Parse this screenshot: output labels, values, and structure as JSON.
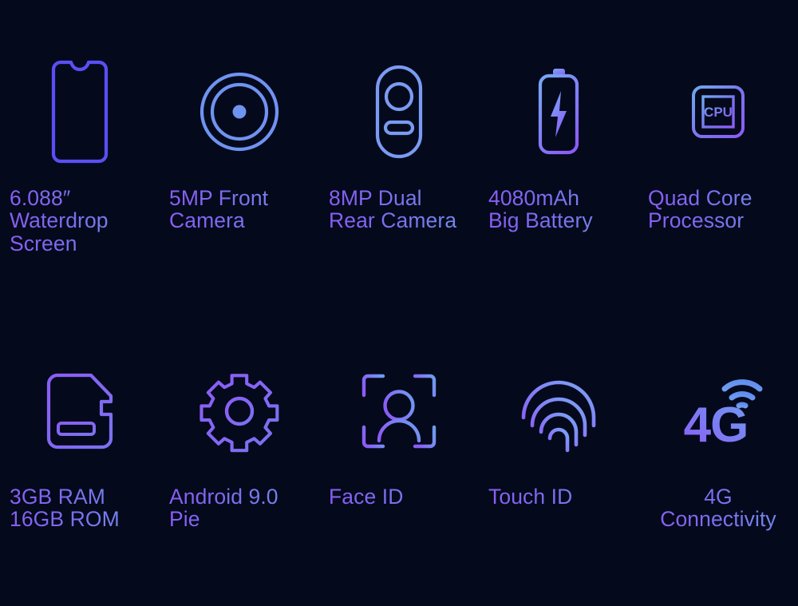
{
  "page": {
    "background_color": "#05091c",
    "layout": "2 rows x 5 columns feature grid",
    "text_gradient_from": "#8b5cf6",
    "text_gradient_to": "#6f8fe8"
  },
  "features": [
    {
      "id": "waterdrop-screen",
      "icon": "phone-waterdrop-notch-icon",
      "icon_color_from": "#5a4ef5",
      "icon_color_to": "#5a4ef5",
      "label": "6.088″\nWaterdrop\nScreen",
      "align": "left"
    },
    {
      "id": "front-camera",
      "icon": "front-camera-lens-icon",
      "icon_color_from": "#6f93f0",
      "icon_color_to": "#6f93f0",
      "label": "5MP Front\nCamera",
      "align": "left"
    },
    {
      "id": "rear-camera",
      "icon": "dual-rear-camera-module-icon",
      "icon_color_from": "#7a9bf2",
      "icon_color_to": "#7a9bf2",
      "label": "8MP Dual\nRear Camera",
      "align": "left"
    },
    {
      "id": "battery",
      "icon": "battery-bolt-icon",
      "icon_color_from": "#77a4f5",
      "icon_color_to": "#8b5cf6",
      "label": "4080mAh\nBig Battery",
      "align": "left"
    },
    {
      "id": "processor",
      "icon": "cpu-chip-icon",
      "icon_color_from": "#6fa8f0",
      "icon_color_to": "#8b5cf6",
      "icon_text": "CPU",
      "label": "Quad Core\nProcessor",
      "align": "left"
    },
    {
      "id": "memory",
      "icon": "sd-memory-card-icon",
      "icon_color_from": "#8b5cf6",
      "icon_color_to": "#7b73ef",
      "label": "3GB RAM\n16GB ROM",
      "align": "left"
    },
    {
      "id": "android-version",
      "icon": "gear-settings-icon",
      "icon_color_from": "#8b5cf6",
      "icon_color_to": "#7b73ef",
      "label": "Android 9.0 Pie",
      "align": "left"
    },
    {
      "id": "face-id",
      "icon": "face-scan-person-icon",
      "icon_color_from": "#8b5cf6",
      "icon_color_to": "#6f9bf0",
      "label": "Face ID",
      "align": "left"
    },
    {
      "id": "touch-id",
      "icon": "fingerprint-icon",
      "icon_color_from": "#8b5cf6",
      "icon_color_to": "#7aa6f5",
      "label": "Touch ID",
      "align": "left"
    },
    {
      "id": "connectivity",
      "icon": "4g-signal-icon",
      "icon_color_from": "#8b5cf6",
      "icon_color_to": "#6f9bf0",
      "icon_text": "4G",
      "label": "4G\nConnectivity",
      "align": "center"
    }
  ]
}
